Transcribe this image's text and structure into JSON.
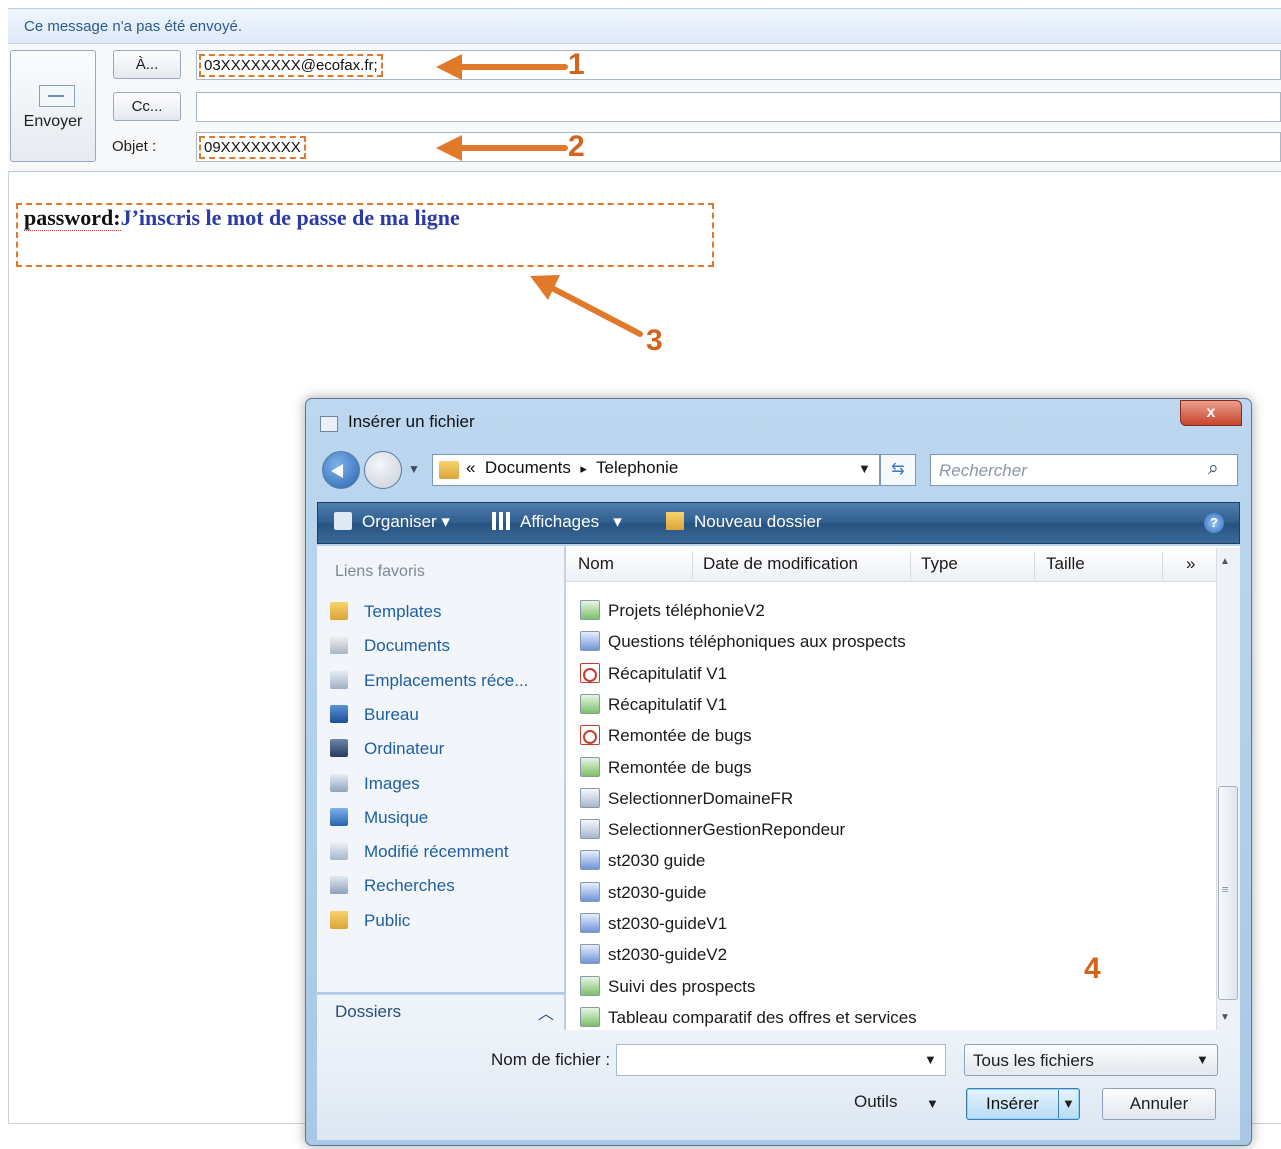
{
  "mail": {
    "infobar": "Ce message n'a pas été envoyé.",
    "send_label": "Envoyer",
    "to_button": "À...",
    "cc_button": "Cc...",
    "subject_label": "Objet :",
    "to_value": "03XXXXXXXX@ecofax.fr;",
    "subject_value": "09XXXXXXXX",
    "body_key": "password:",
    "body_value": "J’inscris le mot de passe de ma ligne"
  },
  "annotations": [
    "1",
    "2",
    "3",
    "4"
  ],
  "dialog": {
    "title": "Insérer un fichier",
    "breadcrumb": [
      "«",
      "Documents",
      "▸",
      "Telephonie"
    ],
    "search_placeholder": "Rechercher",
    "toolbar": {
      "organize": "Organiser",
      "views": "Affichages",
      "new_folder": "Nouveau dossier"
    },
    "favorites_header": "Liens favoris",
    "favorites": [
      {
        "label": "Templates",
        "icon": "folder-icon"
      },
      {
        "label": "Documents",
        "icon": "documents-icon"
      },
      {
        "label": "Emplacements réce...",
        "icon": "recent-places-icon"
      },
      {
        "label": "Bureau",
        "icon": "desktop-icon"
      },
      {
        "label": "Ordinateur",
        "icon": "computer-icon"
      },
      {
        "label": "Images",
        "icon": "pictures-icon"
      },
      {
        "label": "Musique",
        "icon": "music-icon"
      },
      {
        "label": "Modifié récemment",
        "icon": "recently-changed-icon"
      },
      {
        "label": "Recherches",
        "icon": "searches-icon"
      },
      {
        "label": "Public",
        "icon": "folder-icon"
      }
    ],
    "folders_label": "Dossiers",
    "columns": [
      "Nom",
      "Date de modification",
      "Type",
      "Taille",
      "»"
    ],
    "files": [
      {
        "name": "Projets téléphonieV2",
        "kind": "xls"
      },
      {
        "name": "Questions téléphoniques aux prospects",
        "kind": "doc"
      },
      {
        "name": "Récapitulatif V1",
        "kind": "pdf"
      },
      {
        "name": "Récapitulatif V1",
        "kind": "xls"
      },
      {
        "name": "Remontée de bugs",
        "kind": "pdf"
      },
      {
        "name": "Remontée de bugs",
        "kind": "xls"
      },
      {
        "name": "SelectionnerDomaineFR",
        "kind": "img"
      },
      {
        "name": "SelectionnerGestionRepondeur",
        "kind": "img"
      },
      {
        "name": "st2030 guide",
        "kind": "doc"
      },
      {
        "name": "st2030-guide",
        "kind": "doc"
      },
      {
        "name": "st2030-guideV1",
        "kind": "doc"
      },
      {
        "name": "st2030-guideV2",
        "kind": "doc"
      },
      {
        "name": "Suivi des prospects",
        "kind": "xls"
      },
      {
        "name": "Tableau comparatif des offres et services",
        "kind": "xls"
      }
    ],
    "filename_label": "Nom de fichier :",
    "filename_value": "",
    "filter": "Tous les fichiers",
    "tools": "Outils",
    "insert": "Insérer",
    "cancel": "Annuler",
    "close": "x"
  },
  "colors": {
    "accent_orange": "#e07a2a",
    "link_blue": "#1f5fa0",
    "toolbar_blue": "#2f5d8e"
  }
}
